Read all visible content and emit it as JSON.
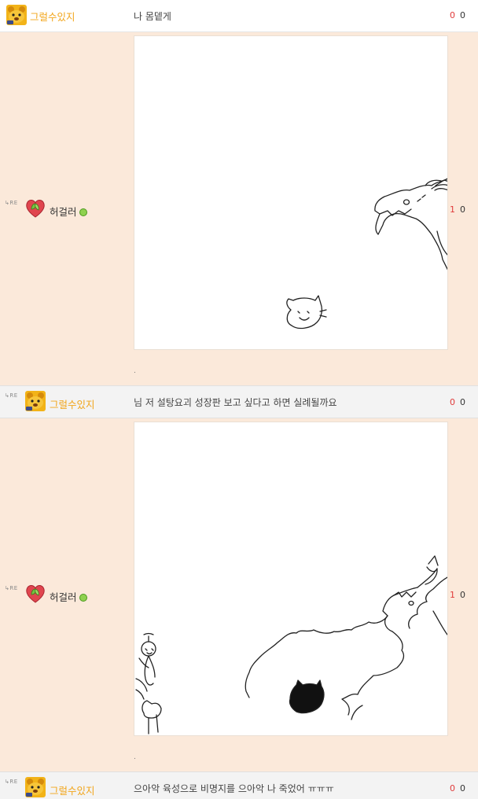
{
  "comments": [
    {
      "is_reply": false,
      "re": "",
      "avatar": "yellow-bear-avatar-icon",
      "nickname": "그럴수있지",
      "text": "나 몸뎉게",
      "up": "0",
      "down": "0"
    },
    {
      "is_reply": true,
      "re": "RE",
      "avatar": "heart-leaf-avatar-icon",
      "nickname": "허걸러",
      "online": true,
      "text": ".",
      "up": "1",
      "down": "0"
    },
    {
      "is_reply": true,
      "re": "RE",
      "avatar": "yellow-bear-avatar-icon",
      "nickname": "그럴수있지",
      "text": "님 저 설탕요괴 성장판 보고 싶다고 하면 실례될까요",
      "up": "0",
      "down": "0"
    },
    {
      "is_reply": true,
      "re": "RE",
      "avatar": "heart-leaf-avatar-icon",
      "nickname": "허걸러",
      "online": true,
      "text": ".",
      "up": "1",
      "down": "0"
    },
    {
      "is_reply": true,
      "re": "RE",
      "avatar": "yellow-bear-avatar-icon",
      "nickname": "그럴수있지",
      "text": "으아악 육성으로 비명지를 으아악 나 죽었어 ㅠㅠㅠ",
      "up": "0",
      "down": "0"
    }
  ],
  "colors": {
    "nickname_yellow": "#f2a51a",
    "upvote_red": "#e03a3a",
    "reply_bg": "#fbe9da",
    "row_grey": "#f3f3f3"
  }
}
